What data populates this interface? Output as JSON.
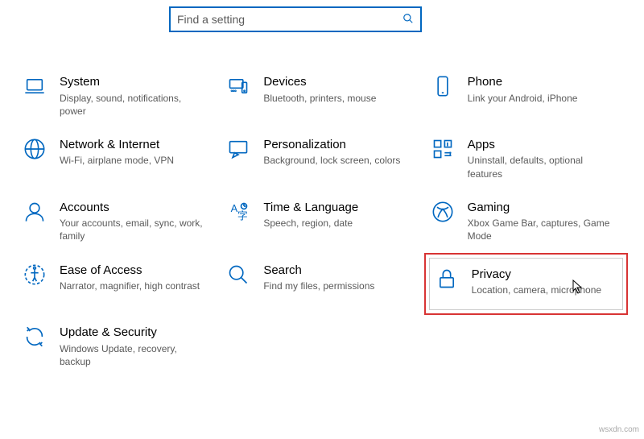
{
  "search": {
    "placeholder": "Find a setting"
  },
  "tiles": {
    "system": {
      "title": "System",
      "desc": "Display, sound, notifications, power"
    },
    "devices": {
      "title": "Devices",
      "desc": "Bluetooth, printers, mouse"
    },
    "phone": {
      "title": "Phone",
      "desc": "Link your Android, iPhone"
    },
    "network": {
      "title": "Network & Internet",
      "desc": "Wi-Fi, airplane mode, VPN"
    },
    "personalization": {
      "title": "Personalization",
      "desc": "Background, lock screen, colors"
    },
    "apps": {
      "title": "Apps",
      "desc": "Uninstall, defaults, optional features"
    },
    "accounts": {
      "title": "Accounts",
      "desc": "Your accounts, email, sync, work, family"
    },
    "time": {
      "title": "Time & Language",
      "desc": "Speech, region, date"
    },
    "gaming": {
      "title": "Gaming",
      "desc": "Xbox Game Bar, captures, Game Mode"
    },
    "ease": {
      "title": "Ease of Access",
      "desc": "Narrator, magnifier, high contrast"
    },
    "search": {
      "title": "Search",
      "desc": "Find my files, permissions"
    },
    "privacy": {
      "title": "Privacy",
      "desc": "Location, camera, microphone"
    },
    "update": {
      "title": "Update & Security",
      "desc": "Windows Update, recovery, backup"
    }
  },
  "watermark": "wsxdn.com"
}
